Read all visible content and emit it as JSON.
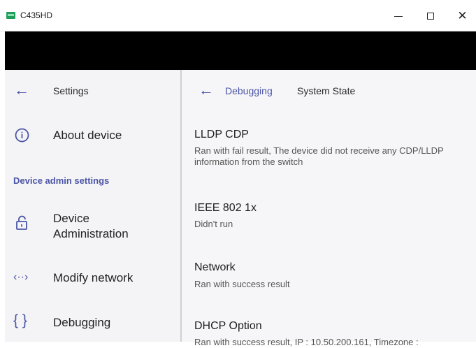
{
  "window": {
    "title": "C435HD",
    "minimize_icon": "minimize-icon",
    "maximize_icon": "maximize-icon",
    "close_icon": "close-icon"
  },
  "sidebar": {
    "header": "Settings",
    "items": [
      {
        "label": "About device",
        "icon": "info-icon"
      },
      {
        "label": "Device Administration",
        "icon": "unlock-icon"
      },
      {
        "label": "Modify network",
        "icon": "network-arrows-icon"
      },
      {
        "label": "Debugging",
        "icon": "braces-icon"
      }
    ],
    "section_header": "Device admin settings"
  },
  "main": {
    "breadcrumb": {
      "parent": "Debugging",
      "current": "System State"
    },
    "items": [
      {
        "title": "LLDP CDP",
        "subtitle": "Ran with fail result, The device did not receive any CDP/LLDP information from the switch"
      },
      {
        "title": "IEEE 802 1x",
        "subtitle": "Didn't run"
      },
      {
        "title": "Network",
        "subtitle": "Ran with success result"
      },
      {
        "title": "DHCP Option",
        "subtitle": "Ran with success result, IP : 10.50.200.161, Timezone :"
      }
    ]
  },
  "colors": {
    "accent": "#4b55a6",
    "left_pane_bg": "#f4f4f6",
    "right_pane_bg": "#f6f6f8",
    "black_band": "#000000"
  }
}
